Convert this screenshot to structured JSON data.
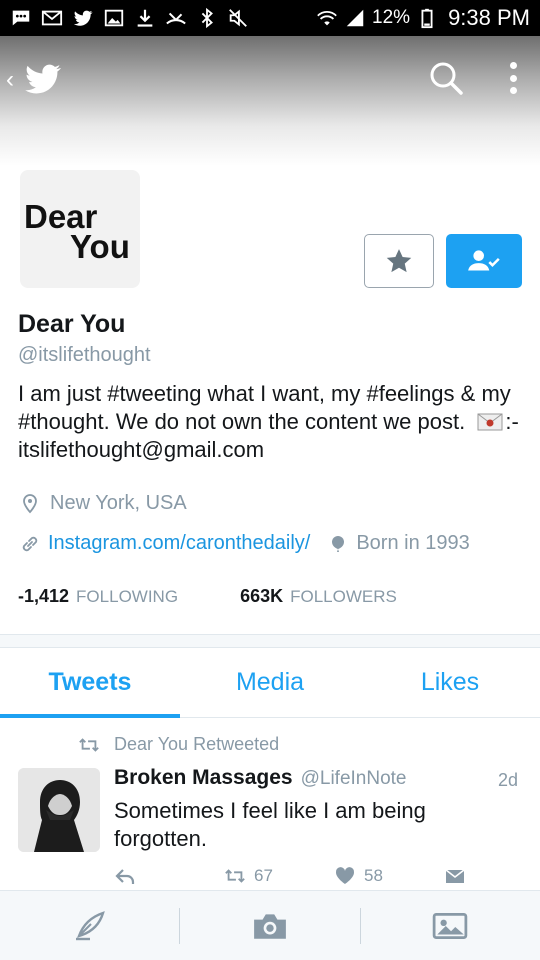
{
  "status_bar": {
    "battery": "12%",
    "time": "9:38 PM",
    "icons": [
      "messages-icon",
      "mail-icon",
      "twitter-icon",
      "image-icon",
      "download-icon",
      "missed-call-icon",
      "bluetooth-icon",
      "mute-icon",
      "wifi-icon",
      "signal-icon",
      "battery-icon"
    ]
  },
  "header": {
    "back_icon": "chevron-left-icon",
    "logo_icon": "twitter-bird-icon",
    "search_icon": "search-icon",
    "more_icon": "more-vertical-icon"
  },
  "profile": {
    "avatar_line1": "Dear",
    "avatar_line2": "You",
    "name": "Dear You",
    "handle": "@itslifethought",
    "bio_part1": "I am just #tweeting what I want, my #feelings & my #thought. We do not own the content we post.",
    "bio_part2": ":- itslifethought@gmail.com",
    "location": "New York,  USA",
    "url": "Instagram.com/caronthedaily/",
    "born": "Born in 1993",
    "following_count": "-1,412",
    "following_label": "FOLLOWING",
    "followers_count": "663K",
    "followers_label": "FOLLOWERS"
  },
  "tabs": [
    {
      "label": "Tweets",
      "active": true
    },
    {
      "label": "Media",
      "active": false
    },
    {
      "label": "Likes",
      "active": false
    }
  ],
  "tweet": {
    "retweeted_by": "Dear You Retweeted",
    "author_name": "Broken Massages",
    "author_handle": "@LifeInNote",
    "time": "2d",
    "text": "Sometimes I feel like I am being forgotten.",
    "retweets": "67",
    "likes": "58"
  },
  "colors": {
    "accent": "#1da1f2",
    "link": "#1b95e0",
    "muted": "#8899a6",
    "text": "#14171a"
  }
}
